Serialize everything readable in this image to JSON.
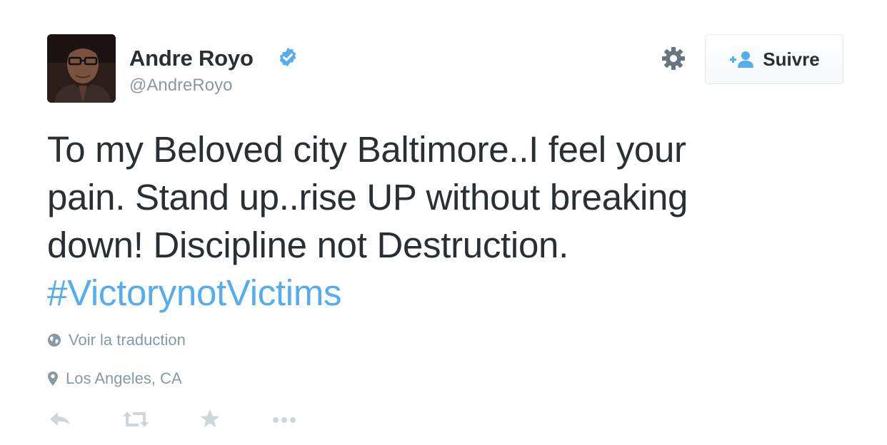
{
  "author": {
    "name": "Andre Royo",
    "handle": "@AndreRoyo",
    "verified": true
  },
  "follow_button": {
    "label": "Suivre",
    "icon": "add-user-icon"
  },
  "tweet": {
    "line1": "To my Beloved city Baltimore..I feel your",
    "line2": "pain. Stand up..rise UP without breaking",
    "line3": "down! Discipline not Destruction.",
    "hashtag": "#VictorynotVictims"
  },
  "translate_link": {
    "icon": "globe-icon",
    "label": "Voir la traduction"
  },
  "location": {
    "icon": "location-pin-icon",
    "label": "Los Angeles, CA"
  },
  "actions": [
    {
      "icon": "reply-icon"
    },
    {
      "icon": "retweet-icon"
    },
    {
      "icon": "favorite-star-icon"
    },
    {
      "icon": "more-icon"
    }
  ],
  "colors": {
    "text": "#292f33",
    "muted": "#8899a6",
    "link": "#55acee",
    "verified_badge": "#55acee",
    "border": "#e1e8ed"
  }
}
